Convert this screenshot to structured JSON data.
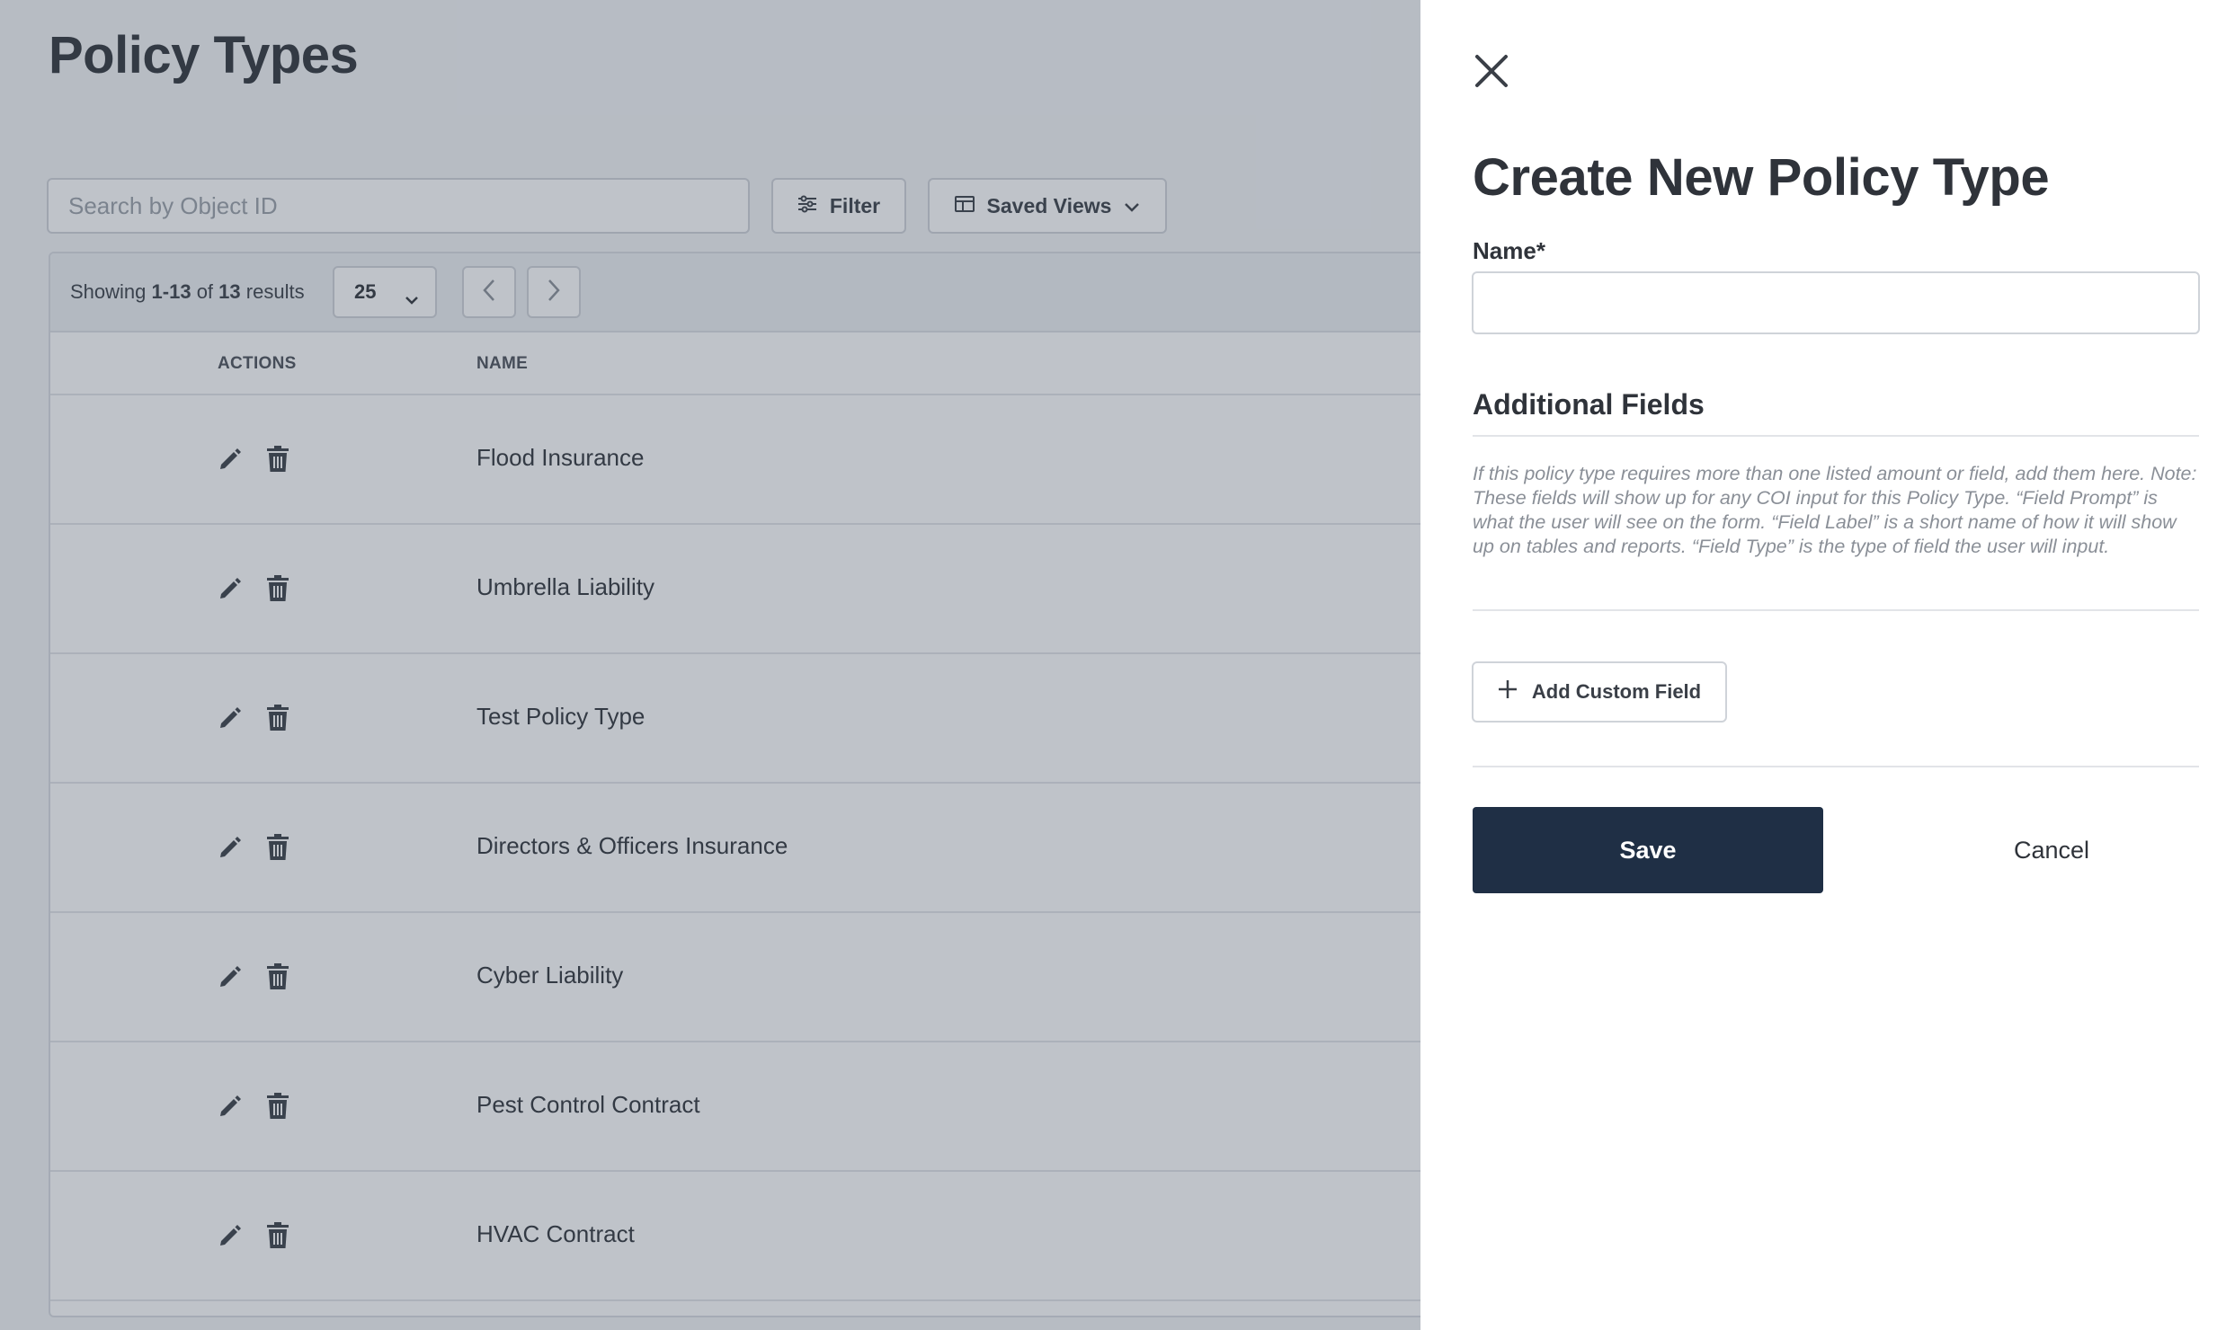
{
  "page": {
    "title": "Policy Types"
  },
  "toolbar": {
    "search_placeholder": "Search by Object ID",
    "filter_label": "Filter",
    "saved_views_label": "Saved Views"
  },
  "pagination": {
    "showing_prefix": "Showing",
    "range": "1-13",
    "of_word": "of",
    "total": "13",
    "results_word": "results",
    "per_page": "25"
  },
  "table": {
    "columns": [
      "ACTIONS",
      "NAME"
    ],
    "rows": [
      {
        "name": "Flood Insurance"
      },
      {
        "name": "Umbrella Liability"
      },
      {
        "name": "Test Policy Type"
      },
      {
        "name": "Directors & Officers Insurance"
      },
      {
        "name": "Cyber Liability"
      },
      {
        "name": "Pest Control Contract"
      },
      {
        "name": "HVAC Contract"
      }
    ]
  },
  "drawer": {
    "title": "Create New Policy Type",
    "name_label": "Name*",
    "name_value": "",
    "additional_fields_title": "Additional Fields",
    "additional_fields_description": "If this policy type requires more than one listed amount or field, add them here. Note: These fields will show up for any COI input for this Policy Type. “Field Prompt” is what the user will see on the form. “Field Label” is a short name of how it will show up on tables and reports. “Field Type” is the type of field the user will input.",
    "add_custom_field_label": "Add Custom Field",
    "save_label": "Save",
    "cancel_label": "Cancel"
  },
  "icons": {
    "close": "close-icon",
    "filter": "sliders-icon",
    "saved_views": "columns-icon",
    "chevron": "chevron-down-icon",
    "prev": "chevron-left-icon",
    "next": "chevron-right-icon",
    "edit": "pencil-icon",
    "delete": "trash-icon",
    "add": "plus-icon"
  },
  "colors": {
    "primary_button": "#1f2f45",
    "overlay": "rgba(60,72,92,0.33)"
  }
}
